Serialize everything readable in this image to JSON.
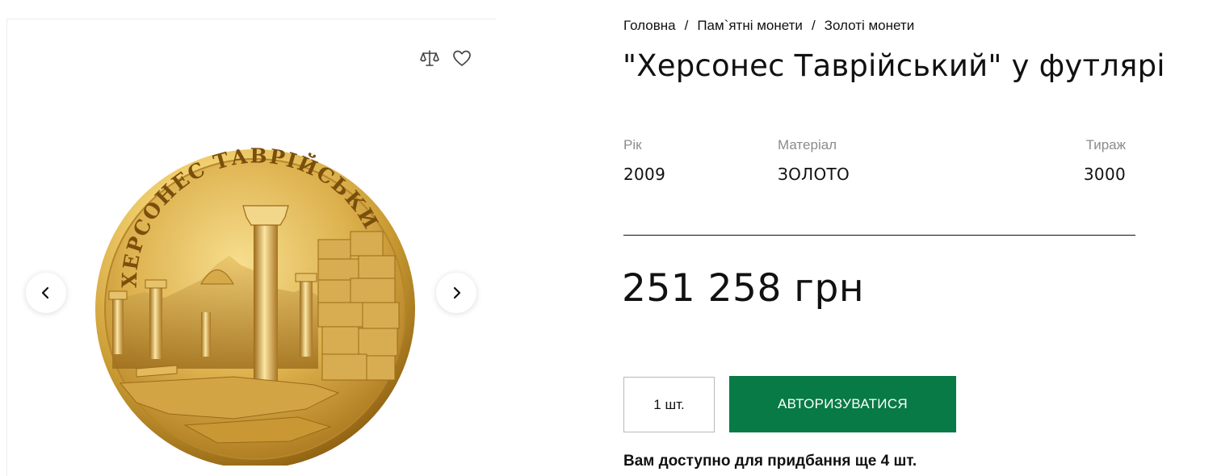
{
  "breadcrumb": {
    "items": [
      "Головна",
      "Пам`ятні монети",
      "Золоті монети"
    ],
    "separator": "/"
  },
  "product": {
    "title": "\"Херсонес Таврійський\" у футлярі",
    "coin_inscription": "ХЕРСОНЕС ТАВРІЙСЬКИЙ",
    "specs": {
      "year": {
        "label": "Рік",
        "value": "2009"
      },
      "material": {
        "label": "Матеріал",
        "value": "ЗОЛОТО"
      },
      "mintage": {
        "label": "Тираж",
        "value": "3000"
      }
    },
    "price": "251 258 грн"
  },
  "purchase": {
    "quantity_value": "1 шт.",
    "auth_button_label": "АВТОРИЗУВАТИСЯ",
    "availability_text": "Вам доступно для придбання ще 4 шт."
  },
  "gallery": {
    "icons": {
      "compare": "scales-icon",
      "favorite": "heart-icon",
      "prev": "chevron-left-icon",
      "next": "chevron-right-icon"
    }
  },
  "colors": {
    "accent_button": "#077a45",
    "gold_light": "#f3d77f",
    "gold_dark": "#8a5c0f",
    "divider": "#111111",
    "spec_label": "#8c8c8c"
  }
}
